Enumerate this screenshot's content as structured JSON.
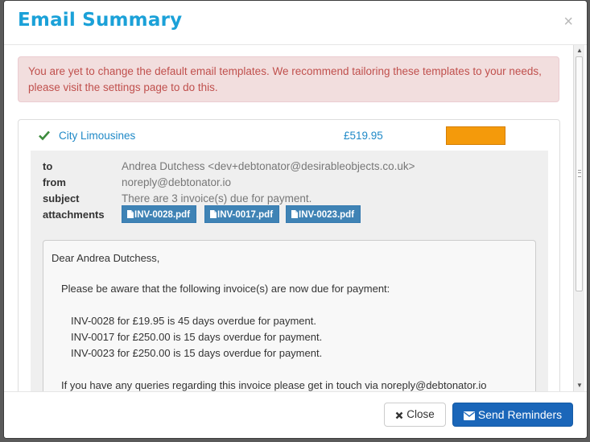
{
  "modal": {
    "title": "Email Summary",
    "close_symbol": "×"
  },
  "alert": {
    "text": "You are yet to change the default email templates. We recommend tailoring these templates to your needs, please visit the settings page to do this."
  },
  "invoice_row": {
    "status_icon": "check-icon",
    "company": "City Limousines",
    "amount": "£519.95",
    "status_color": "#f49a0b"
  },
  "email": {
    "labels": {
      "to": "to",
      "from": "from",
      "subject": "subject",
      "attachments": "attachments"
    },
    "to": "Andrea Dutchess <dev+debtonator@desirableobjects.co.uk>",
    "from": "noreply@debtonator.io",
    "subject": "There are 3 invoice(s) due for payment.",
    "attachments": [
      "INV-0028.pdf",
      "INV-0017.pdf",
      "INV-0023.pdf"
    ],
    "body": {
      "greeting": "Dear Andrea Dutchess,",
      "intro": "Please be aware that the following invoice(s) are now due for payment:",
      "lines": [
        "INV-0028 for £19.95 is 45 days overdue for payment.",
        "INV-0017 for £250.00 is 15 days overdue for payment.",
        "INV-0023 for £250.00 is 15 days overdue for payment."
      ],
      "closing": "If you have any queries regarding this invoice please get in touch via noreply@debtonator.io"
    }
  },
  "footer": {
    "close_label": "Close",
    "send_label": "Send Reminders"
  },
  "colors": {
    "title": "#1ba1d8",
    "primary_button": "#1a66b9",
    "attachment_button": "#3f83b5",
    "alert_text": "#c0504d"
  }
}
